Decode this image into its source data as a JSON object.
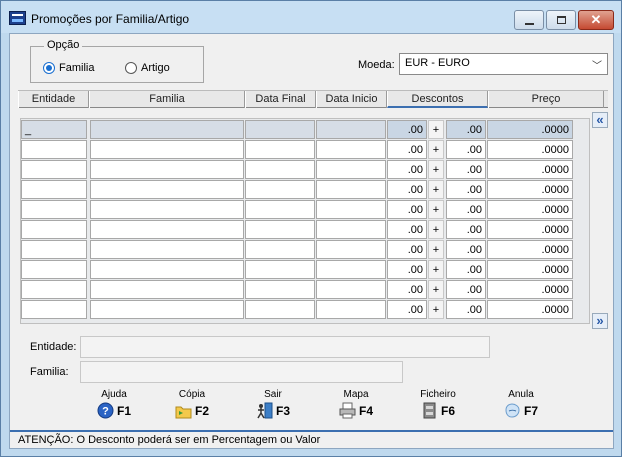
{
  "window": {
    "title": "Promoções por Familia/Artigo"
  },
  "opcao": {
    "legend": "Opção",
    "options": [
      {
        "label": "Familia",
        "selected": true
      },
      {
        "label": "Artigo",
        "selected": false
      }
    ]
  },
  "moeda": {
    "label": "Moeda:",
    "value": "EUR - EURO"
  },
  "table": {
    "headers": [
      "Entidade",
      "Familia",
      "Data Final",
      "Data Inicio",
      "Descontos",
      "Preço"
    ],
    "rows": [
      {
        "entidade": "_",
        "desc1": ".00",
        "op": "+",
        "desc2": ".00",
        "preco": ".0000"
      },
      {
        "entidade": "",
        "desc1": ".00",
        "op": "+",
        "desc2": ".00",
        "preco": ".0000"
      },
      {
        "entidade": "",
        "desc1": ".00",
        "op": "+",
        "desc2": ".00",
        "preco": ".0000"
      },
      {
        "entidade": "",
        "desc1": ".00",
        "op": "+",
        "desc2": ".00",
        "preco": ".0000"
      },
      {
        "entidade": "",
        "desc1": ".00",
        "op": "+",
        "desc2": ".00",
        "preco": ".0000"
      },
      {
        "entidade": "",
        "desc1": ".00",
        "op": "+",
        "desc2": ".00",
        "preco": ".0000"
      },
      {
        "entidade": "",
        "desc1": ".00",
        "op": "+",
        "desc2": ".00",
        "preco": ".0000"
      },
      {
        "entidade": "",
        "desc1": ".00",
        "op": "+",
        "desc2": ".00",
        "preco": ".0000"
      },
      {
        "entidade": "",
        "desc1": ".00",
        "op": "+",
        "desc2": ".00",
        "preco": ".0000"
      },
      {
        "entidade": "",
        "desc1": ".00",
        "op": "+",
        "desc2": ".00",
        "preco": ".0000"
      }
    ]
  },
  "info": {
    "entidade_label": "Entidade:",
    "familia_label": "Familia:"
  },
  "buttons": [
    {
      "label": "Ajuda",
      "key": "F1",
      "icon": "help-icon"
    },
    {
      "label": "Cópia",
      "key": "F2",
      "icon": "folder-copy-icon"
    },
    {
      "label": "Sair",
      "key": "F3",
      "icon": "exit-icon"
    },
    {
      "label": "Mapa",
      "key": "F4",
      "icon": "printer-icon"
    },
    {
      "label": "Ficheiro",
      "key": "F6",
      "icon": "file-cabinet-icon"
    },
    {
      "label": "Anula",
      "key": "F7",
      "icon": "cancel-icon"
    }
  ],
  "status": {
    "text": "ATENÇÃO: O Desconto poderá ser em Percentagem ou Valor"
  }
}
